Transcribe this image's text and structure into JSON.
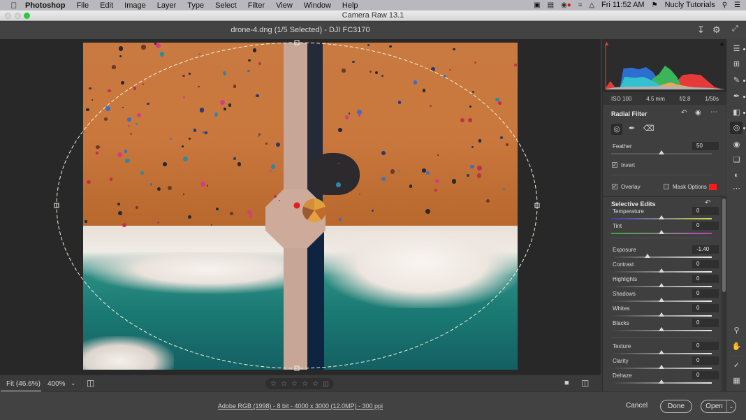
{
  "menubar": {
    "apple": "",
    "app": "Photoshop",
    "items": [
      "File",
      "Edit",
      "Image",
      "Layer",
      "Type",
      "Select",
      "Filter",
      "View",
      "Window",
      "Help"
    ],
    "clock": "Fri 11:52 AM",
    "user": "Nucly Tutorials"
  },
  "window": {
    "title": "Camera Raw 13.1",
    "traffic_lights": {
      "close": "#d9d9d9",
      "minimize": "#d9d9d9",
      "zoom": "#2ac840"
    }
  },
  "docbar": {
    "doc_name": "drone-4.dng (1/5 Selected)  -  DJI FC3170"
  },
  "canvas": {
    "pin_color": "#e02020",
    "overlay_line_color": "#f2f2dc"
  },
  "bottom_strip": {
    "fit_label": "Fit (46.6%)",
    "zoom_label": "400%",
    "rating_stars": [
      "☆",
      "☆",
      "☆",
      "☆",
      "☆"
    ],
    "rating_value": 0,
    "trash": "🗑"
  },
  "footer": {
    "image_info": "Adobe RGB (1998) - 8 bit - 4000 x 3000 (12.0MP) - 300 ppi",
    "cancel": "Cancel",
    "done": "Done",
    "open": "Open"
  },
  "histogram": {
    "channels": [
      "red",
      "green",
      "blue",
      "cyan",
      "yellow",
      "gray"
    ],
    "colors": {
      "red": "#e53a3a",
      "green": "#3cb55a",
      "blue": "#2d6fd0",
      "cyan": "#33c1d0",
      "yellow": "#e8a65a",
      "gray": "#b3b3b3"
    }
  },
  "exif": {
    "iso": "ISO 100",
    "focal": "4.5 mm",
    "aperture": "f/2.8",
    "shutter": "1/50s"
  },
  "radial_filter": {
    "title": "Radial Filter",
    "feather_label": "Feather",
    "feather_value": "50",
    "feather_fraction": 0.5,
    "invert_label": "Invert",
    "invert_checked": true,
    "overlay_label": "Overlay",
    "overlay_checked": true,
    "mask_options_label": "Mask Options",
    "mask_options_checked": false,
    "mask_color": "#ff1a1a"
  },
  "selective_edits": {
    "title": "Selective Edits",
    "sliders": [
      {
        "label": "Temperature",
        "value": "0",
        "fraction": 0.5,
        "track": "temp"
      },
      {
        "label": "Tint",
        "value": "0",
        "fraction": 0.5,
        "track": "tint"
      },
      {
        "label": "Exposure",
        "value": "-1.40",
        "fraction": 0.36,
        "track": "gray"
      },
      {
        "label": "Contrast",
        "value": "0",
        "fraction": 0.5,
        "track": "gray"
      },
      {
        "label": "Highlights",
        "value": "0",
        "fraction": 0.5,
        "track": "gray"
      },
      {
        "label": "Shadows",
        "value": "0",
        "fraction": 0.5,
        "track": "gray"
      },
      {
        "label": "Whites",
        "value": "0",
        "fraction": 0.5,
        "track": "gray"
      },
      {
        "label": "Blacks",
        "value": "0",
        "fraction": 0.5,
        "track": "gray"
      },
      {
        "label": "Texture",
        "value": "0",
        "fraction": 0.5,
        "track": "gray"
      },
      {
        "label": "Clarity",
        "value": "0",
        "fraction": 0.5,
        "track": "gray"
      },
      {
        "label": "Dehaze",
        "value": "0",
        "fraction": 0.5,
        "track": "gray"
      }
    ]
  },
  "toolstrip": {
    "tools": [
      "edit-icon",
      "crop-icon",
      "healing-icon",
      "brush-icon",
      "graduated-filter-icon",
      "radial-filter-icon",
      "red-eye-icon",
      "snapshots-icon",
      "presets-icon",
      "more-icon"
    ],
    "bottom_tools": [
      "zoom-icon",
      "hand-icon",
      "sampler-icon",
      "grid-icon"
    ],
    "selected": "radial-filter-icon"
  }
}
